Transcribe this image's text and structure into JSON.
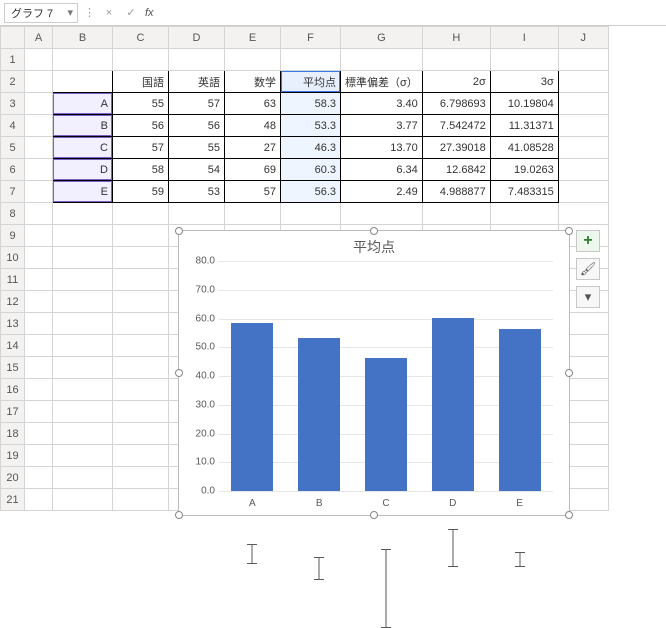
{
  "formula_bar": {
    "name_box": "グラフ 7",
    "cancel": "×",
    "enter": "✓",
    "fx": "fx"
  },
  "columns": [
    "",
    "A",
    "B",
    "C",
    "D",
    "E",
    "F",
    "G",
    "H",
    "I",
    "J"
  ],
  "row_headers": [
    "1",
    "2",
    "3",
    "4",
    "5",
    "6",
    "7",
    "8",
    "9",
    "10",
    "11",
    "12",
    "13",
    "14",
    "15",
    "16",
    "17",
    "18",
    "19",
    "20",
    "21"
  ],
  "table": {
    "header": {
      "B": "",
      "C": "国語",
      "D": "英語",
      "E": "数学",
      "F": "平均点",
      "G": "標準偏差（σ）",
      "H": "2σ",
      "I": "3σ"
    },
    "rows": [
      {
        "B": "A",
        "C": "55",
        "D": "57",
        "E": "63",
        "F": "58.3",
        "G": "3.40",
        "H": "6.798693",
        "I": "10.19804"
      },
      {
        "B": "B",
        "C": "56",
        "D": "56",
        "E": "48",
        "F": "53.3",
        "G": "3.77",
        "H": "7.542472",
        "I": "11.31371"
      },
      {
        "B": "C",
        "C": "57",
        "D": "55",
        "E": "27",
        "F": "46.3",
        "G": "13.70",
        "H": "27.39018",
        "I": "41.08528"
      },
      {
        "B": "D",
        "C": "58",
        "D": "54",
        "E": "69",
        "F": "60.3",
        "G": "6.34",
        "H": "12.6842",
        "I": "19.0263"
      },
      {
        "B": "E",
        "C": "59",
        "D": "53",
        "E": "57",
        "F": "56.3",
        "G": "2.49",
        "H": "4.988877",
        "I": "7.483315"
      }
    ]
  },
  "side_buttons": {
    "plus": "+",
    "brush": "🖌",
    "filter": "▾"
  },
  "chart_data": {
    "type": "bar",
    "title": "平均点",
    "categories": [
      "A",
      "B",
      "C",
      "D",
      "E"
    ],
    "values": [
      58.3,
      53.3,
      46.3,
      60.3,
      56.3
    ],
    "errors": [
      3.4,
      3.77,
      13.7,
      6.34,
      2.49
    ],
    "ylim": [
      0,
      80
    ],
    "yticks": [
      0,
      10,
      20,
      30,
      40,
      50,
      60,
      70,
      80
    ],
    "ytick_labels": [
      "0.0",
      "10.0",
      "20.0",
      "30.0",
      "40.0",
      "50.0",
      "60.0",
      "70.0",
      "80.0"
    ]
  }
}
